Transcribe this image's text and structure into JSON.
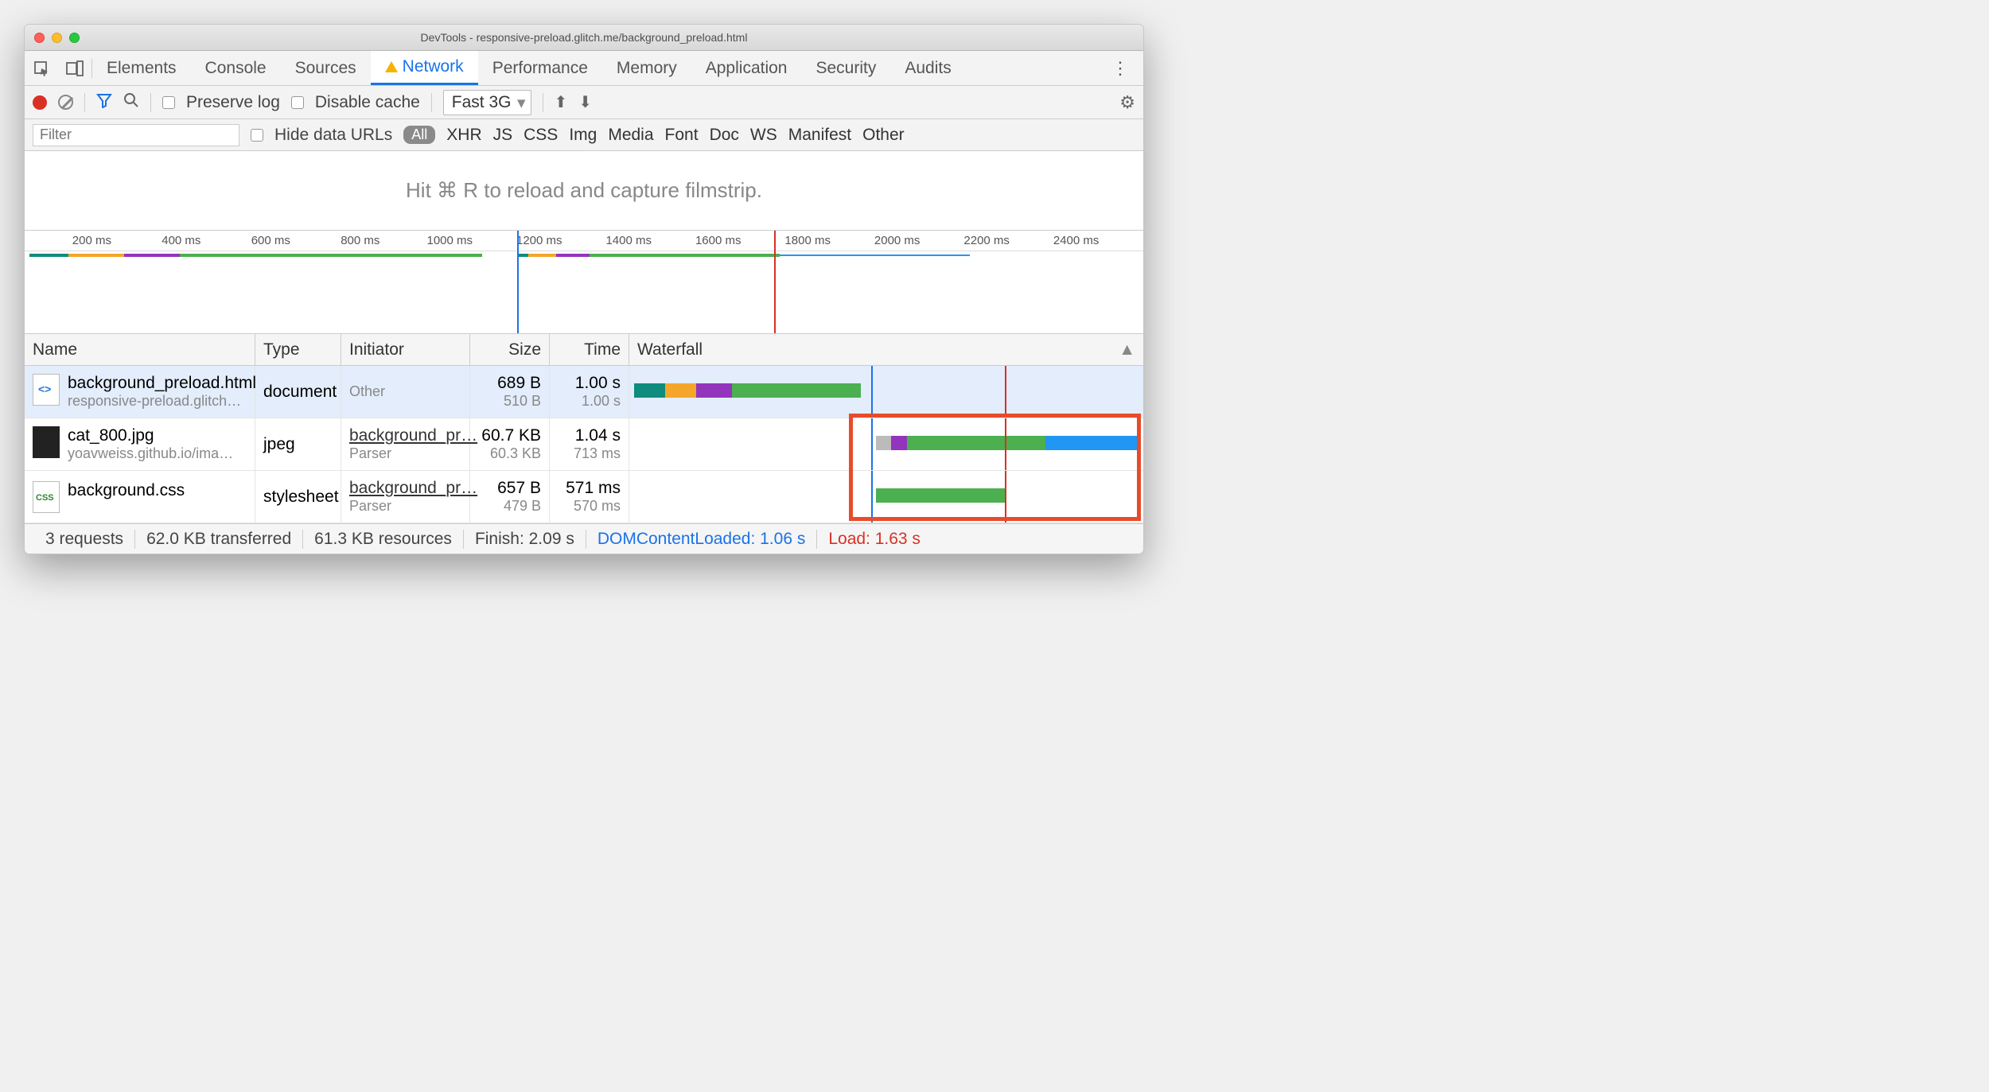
{
  "window": {
    "title": "DevTools - responsive-preload.glitch.me/background_preload.html"
  },
  "tabs": {
    "elements": "Elements",
    "console": "Console",
    "sources": "Sources",
    "network": "Network",
    "performance": "Performance",
    "memory": "Memory",
    "application": "Application",
    "security": "Security",
    "audits": "Audits"
  },
  "toolbar": {
    "preserve": "Preserve log",
    "disable_cache": "Disable cache",
    "throttle": "Fast 3G"
  },
  "filter": {
    "placeholder": "Filter",
    "hide_urls": "Hide data URLs",
    "all": "All",
    "types": [
      "XHR",
      "JS",
      "CSS",
      "Img",
      "Media",
      "Font",
      "Doc",
      "WS",
      "Manifest",
      "Other"
    ]
  },
  "banner": "Hit ⌘ R to reload and capture filmstrip.",
  "timeline": {
    "ticks": [
      "200 ms",
      "400 ms",
      "600 ms",
      "800 ms",
      "1000 ms",
      "1200 ms",
      "1400 ms",
      "1600 ms",
      "1800 ms",
      "2000 ms",
      "2200 ms",
      "2400 ms"
    ]
  },
  "columns": {
    "name": "Name",
    "type": "Type",
    "initiator": "Initiator",
    "size": "Size",
    "time": "Time",
    "waterfall": "Waterfall"
  },
  "rows": [
    {
      "name": "background_preload.html",
      "sub": "responsive-preload.glitch…",
      "type": "document",
      "init": "Other",
      "init_sub": "",
      "size": "689 B",
      "size2": "510 B",
      "time": "1.00 s",
      "time2": "1.00 s"
    },
    {
      "name": "cat_800.jpg",
      "sub": "yoavweiss.github.io/ima…",
      "type": "jpeg",
      "init": "background_pr…",
      "init_sub": "Parser",
      "size": "60.7 KB",
      "size2": "60.3 KB",
      "time": "1.04 s",
      "time2": "713 ms"
    },
    {
      "name": "background.css",
      "sub": "",
      "type": "stylesheet",
      "init": "background_pr…",
      "init_sub": "Parser",
      "size": "657 B",
      "size2": "479 B",
      "time": "571 ms",
      "time2": "570 ms"
    }
  ],
  "status": {
    "requests": "3 requests",
    "transferred": "62.0 KB transferred",
    "resources": "61.3 KB resources",
    "finish": "Finish: 2.09 s",
    "dcl": "DOMContentLoaded: 1.06 s",
    "load": "Load: 1.63 s"
  }
}
